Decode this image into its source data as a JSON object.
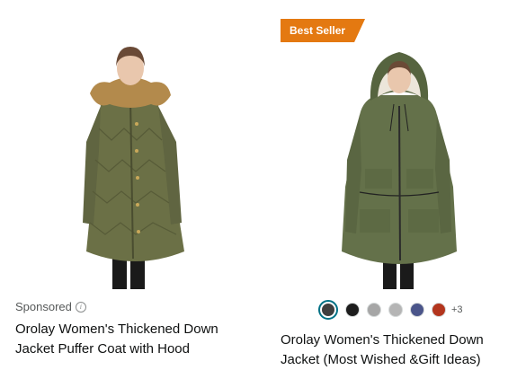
{
  "products": [
    {
      "sponsored_label": "Sponsored",
      "info_icon": "info-icon",
      "title": "Orolay Women's Thickened Down Jacket Puffer Coat with Hood",
      "coat_color": "#6b7046"
    },
    {
      "badge": "Best Seller",
      "title": "Orolay Women's Thickened Down Jacket (Most Wished &Gift Ideas)",
      "coat_color": "#64714a",
      "swatches": [
        "#3f3f3f",
        "#1d1d1d",
        "#a6a6a6",
        "#b5b5b5",
        "#4b558a",
        "#b3351d"
      ],
      "more_colors": "+3"
    }
  ]
}
